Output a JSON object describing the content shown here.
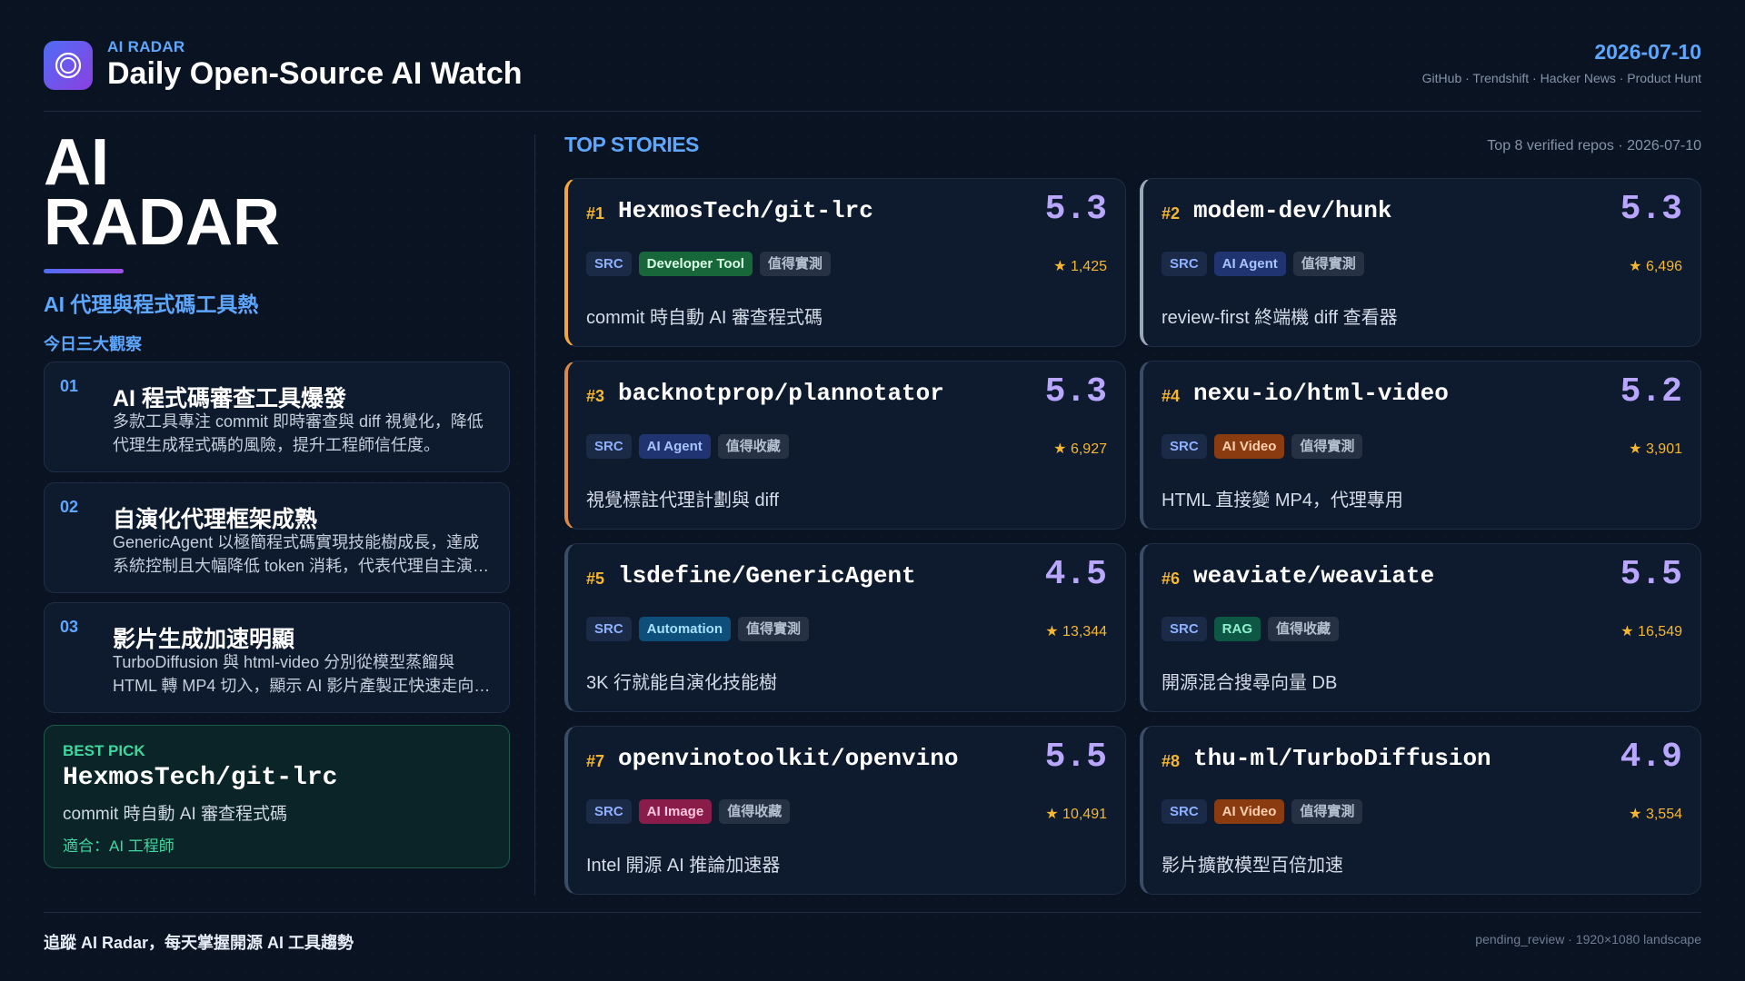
{
  "header": {
    "logo_icon": "radar-circle-icon",
    "brand_small": "AI RADAR",
    "title": "Daily Open-Source AI Watch",
    "date": "2026-07-10",
    "sources": "GitHub · Trendshift · Hacker News · Product Hunt"
  },
  "left": {
    "big_title_line1": "AI",
    "big_title_line2": "RADAR",
    "subtitle": "AI 代理與程式碼工具熱",
    "insights_heading": "今日三大觀察",
    "insights": [
      {
        "num": "01",
        "title": "AI 程式碼審查工具爆發",
        "desc": "多款工具專注 commit 即時審查與 diff 視覺化，降低代理生成程式碼的風險，提升工程師信任度。"
      },
      {
        "num": "02",
        "title": "自演化代理框架成熟",
        "desc": "GenericAgent 以極簡程式碼實現技能樹成長，達成系統控制且大幅降低 token 消耗，代表代理自主演化進入實用階段。"
      },
      {
        "num": "03",
        "title": "影片生成加速明顯",
        "desc": "TurboDiffusion 與 html-video 分別從模型蒸餾與 HTML 轉 MP4 切入，顯示 AI 影片產製正快速走向即時與自動化。"
      }
    ],
    "best_pick": {
      "label": "BEST PICK",
      "name": "HexmosTech/git-lrc",
      "desc": "commit 時自動 AI 審查程式碼",
      "fit": "適合：AI 工程師"
    }
  },
  "right": {
    "heading": "TOP STORIES",
    "meta": "Top 8 verified repos · 2026-07-10",
    "stories": [
      {
        "rank": "#1",
        "repo": "HexmosTech/git-lrc",
        "score": "5.3",
        "src": "SRC",
        "category": "Developer Tool",
        "verdict": "值得實測",
        "stars": "★ 1,425",
        "desc": "commit 時自動 AI 審查程式碼"
      },
      {
        "rank": "#2",
        "repo": "modem-dev/hunk",
        "score": "5.3",
        "src": "SRC",
        "category": "AI Agent",
        "verdict": "值得實測",
        "stars": "★ 6,496",
        "desc": "review-first 終端機 diff 查看器"
      },
      {
        "rank": "#3",
        "repo": "backnotprop/plannotator",
        "score": "5.3",
        "src": "SRC",
        "category": "AI Agent",
        "verdict": "值得收藏",
        "stars": "★ 6,927",
        "desc": "視覺標註代理計劃與 diff"
      },
      {
        "rank": "#4",
        "repo": "nexu-io/html-video",
        "score": "5.2",
        "src": "SRC",
        "category": "AI Video",
        "verdict": "值得實測",
        "stars": "★ 3,901",
        "desc": "HTML 直接變 MP4，代理專用"
      },
      {
        "rank": "#5",
        "repo": "lsdefine/GenericAgent",
        "score": "4.5",
        "src": "SRC",
        "category": "Automation",
        "verdict": "值得實測",
        "stars": "★ 13,344",
        "desc": "3K 行就能自演化技能樹"
      },
      {
        "rank": "#6",
        "repo": "weaviate/weaviate",
        "score": "5.5",
        "src": "SRC",
        "category": "RAG",
        "verdict": "值得收藏",
        "stars": "★ 16,549",
        "desc": "開源混合搜尋向量 DB"
      },
      {
        "rank": "#7",
        "repo": "openvinotoolkit/openvino",
        "score": "5.5",
        "src": "SRC",
        "category": "AI Image",
        "verdict": "值得收藏",
        "stars": "★ 10,491",
        "desc": "Intel 開源 AI 推論加速器"
      },
      {
        "rank": "#8",
        "repo": "thu-ml/TurboDiffusion",
        "score": "4.9",
        "src": "SRC",
        "category": "AI Video",
        "verdict": "值得實測",
        "stars": "★ 3,554",
        "desc": "影片擴散模型百倍加速"
      }
    ]
  },
  "footer": {
    "left": "追蹤 AI Radar，每天掌握開源 AI 工具趨勢",
    "right": "pending_review · 1920×1080 landscape"
  }
}
